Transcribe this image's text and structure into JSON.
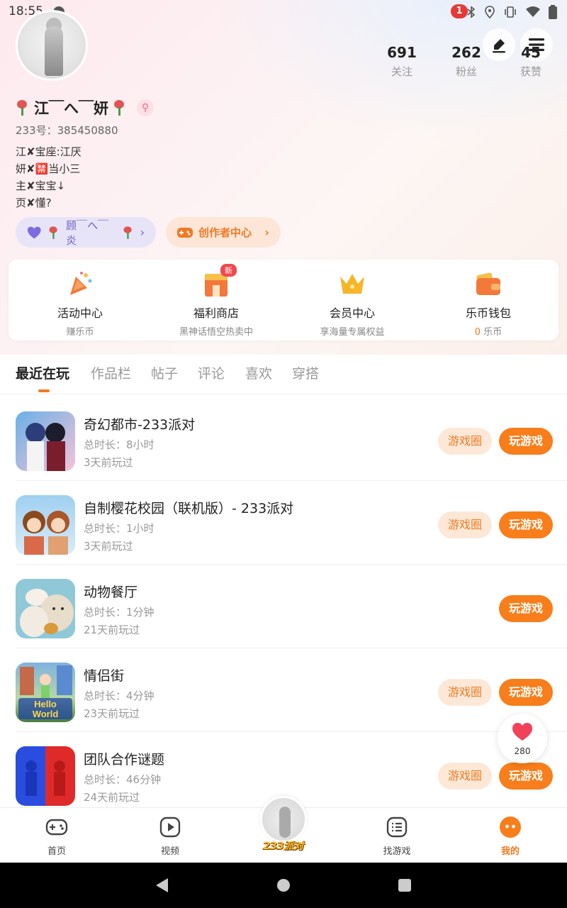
{
  "status_bar": {
    "time": "18:55",
    "notification_count": "1"
  },
  "profile": {
    "nickname": "江￣へ￣妍",
    "gender_symbol": "⚲",
    "uid": "233号：385450880",
    "bio": [
      "江✘宝座:江厌",
      "妍✘🈲当小三",
      "主✘宝宝↓",
      "页✘懂?"
    ],
    "stats": [
      {
        "value": "691",
        "label": "关注"
      },
      {
        "value": "262",
        "label": "粉丝"
      },
      {
        "value": "45",
        "label": "获赞"
      }
    ],
    "friend_chip": "顾￣へ￣炎",
    "creator_chip": "创作者中心"
  },
  "features": [
    {
      "title": "活动中心",
      "subtitle": "赚乐币",
      "icon": "party-popper-icon"
    },
    {
      "title": "福利商店",
      "subtitle": "黑神话悟空热卖中",
      "icon": "shop-icon",
      "badge": "新"
    },
    {
      "title": "会员中心",
      "subtitle": "享海量专属权益",
      "icon": "crown-icon"
    },
    {
      "title": "乐币钱包",
      "subtitle_value": "0",
      "subtitle_unit": "乐币",
      "icon": "wallet-icon"
    }
  ],
  "tabs": [
    "最近在玩",
    "作品栏",
    "帖子",
    "评论",
    "喜欢",
    "穿搭"
  ],
  "games": [
    {
      "name": "奇幻都市-233派对",
      "duration": "总时长：8小时",
      "last_played": "3天前玩过",
      "has_circle": true
    },
    {
      "name": "自制樱花校园（联机版）- 233派对",
      "duration": "总时长：1小时",
      "last_played": "3天前玩过",
      "has_circle": true
    },
    {
      "name": "动物餐厅",
      "duration": "总时长：1分钟",
      "last_played": "21天前玩过",
      "has_circle": false
    },
    {
      "name": "情侣街",
      "duration": "总时长：4分钟",
      "last_played": "23天前玩过",
      "has_circle": true
    },
    {
      "name": "团队合作谜题",
      "duration": "总时长：46分钟",
      "last_played": "24天前玩过",
      "has_circle": true
    }
  ],
  "buttons": {
    "circle": "游戏圈",
    "play": "玩游戏"
  },
  "float_like": {
    "count": "280"
  },
  "bottom_nav": {
    "home": "首页",
    "video": "视频",
    "center": "233派对",
    "find": "找游戏",
    "mine": "我的"
  },
  "colors": {
    "accent": "#f77e1a",
    "accent_light": "#fde8d8",
    "friend_chip": "#e8e4f8"
  }
}
